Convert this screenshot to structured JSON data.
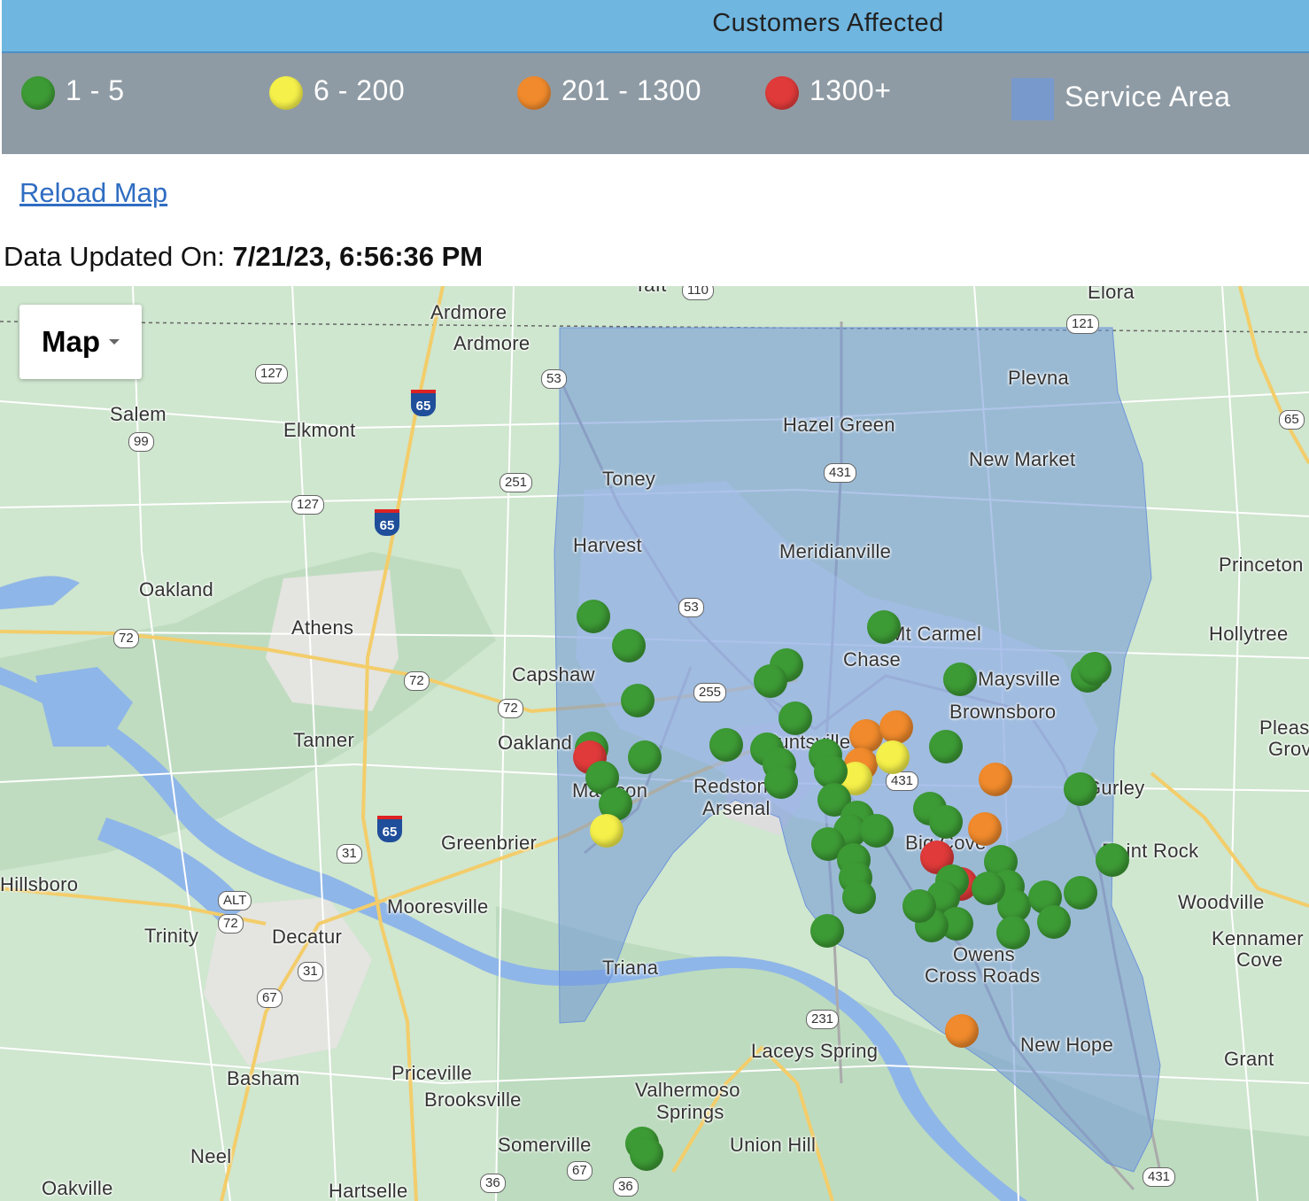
{
  "header": {
    "title": "Customers Affected"
  },
  "legend": {
    "items": [
      {
        "label": "1 - 5",
        "color": "#3d9b35"
      },
      {
        "label": "6 - 200",
        "color": "#f5f04a"
      },
      {
        "label": "201 - 1300",
        "color": "#f08a2c"
      },
      {
        "label": "1300+",
        "color": "#e03a3a"
      }
    ],
    "service_area": {
      "label": "Service Area",
      "color": "#7799cc"
    }
  },
  "reload_link": "Reload Map",
  "updated": {
    "label": "Data Updated On: ",
    "value": "7/21/23, 6:56:36 PM"
  },
  "map": {
    "type_control": "Map",
    "places": [
      "Ardmore",
      "Ardmore",
      "Salem",
      "Elkmont",
      "Hazel Green",
      "Plevna",
      "Toney",
      "New Market",
      "Harvest",
      "Meridianville",
      "Princeton",
      "Oakland",
      "Athens",
      "Mt Carmel",
      "Chase",
      "Hollytree",
      "Capshaw",
      "Maysville",
      "Brownsboro",
      "Tanner",
      "Oakland",
      "Madison",
      "Redstone",
      "Arsenal",
      "Pleas",
      "Grov",
      "Greenbrier",
      "Big Cove",
      "Paint Rock",
      "Hillsboro",
      "Mooresville",
      "Woodville",
      "Trinity",
      "Decatur",
      "Kennamer",
      "Cove",
      "Owens",
      "Cross Roads",
      "Triana",
      "Laceys Spring",
      "New Hope",
      "Grant",
      "Basham",
      "Priceville",
      "Brooksville",
      "Valhermoso",
      "Springs",
      "Union Hill",
      "Neel",
      "Somerville",
      "Oakville",
      "Hartselle",
      "Elora",
      "Taft",
      "Gurley",
      "Huntsville"
    ],
    "routes": [
      "127",
      "53",
      "65",
      "99",
      "251",
      "127",
      "65",
      "431",
      "121",
      "65",
      "53",
      "72",
      "255",
      "72",
      "72",
      "431",
      "65",
      "31",
      "ALT",
      "72",
      "31",
      "67",
      "231",
      "36",
      "67",
      "36",
      "431",
      "110"
    ]
  }
}
